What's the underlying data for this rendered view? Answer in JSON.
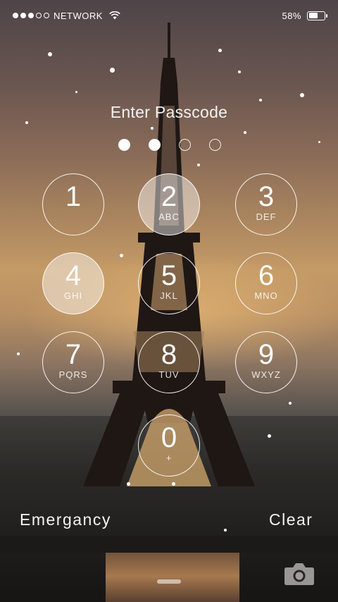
{
  "status_bar": {
    "carrier": "NETWORK",
    "signal_strength": 3,
    "signal_max": 5,
    "battery_text": "58%",
    "battery_level": 0.58,
    "icons": [
      "wifi-icon",
      "battery-icon"
    ]
  },
  "lock": {
    "title": "Enter Passcode",
    "pin_length": 4,
    "pin_entered": 2
  },
  "keypad": [
    {
      "num": "1",
      "letters": "",
      "pressed": false
    },
    {
      "num": "2",
      "letters": "ABC",
      "pressed": true
    },
    {
      "num": "3",
      "letters": "DEF",
      "pressed": false
    },
    {
      "num": "4",
      "letters": "GHI",
      "pressed": true
    },
    {
      "num": "5",
      "letters": "JKL",
      "pressed": false
    },
    {
      "num": "6",
      "letters": "MNO",
      "pressed": false
    },
    {
      "num": "7",
      "letters": "PQRS",
      "pressed": false
    },
    {
      "num": "8",
      "letters": "TUV",
      "pressed": false
    },
    {
      "num": "9",
      "letters": "WXYZ",
      "pressed": false
    },
    {
      "num": "0",
      "letters": "+",
      "pressed": false
    }
  ],
  "bottom": {
    "emergency_label": "Emergancy",
    "clear_label": "Clear",
    "camera_icon": "camera-icon"
  },
  "colors": {
    "sky_top": "#4e4448",
    "sunset": "#c49a66",
    "foreground": "#ffffff"
  }
}
